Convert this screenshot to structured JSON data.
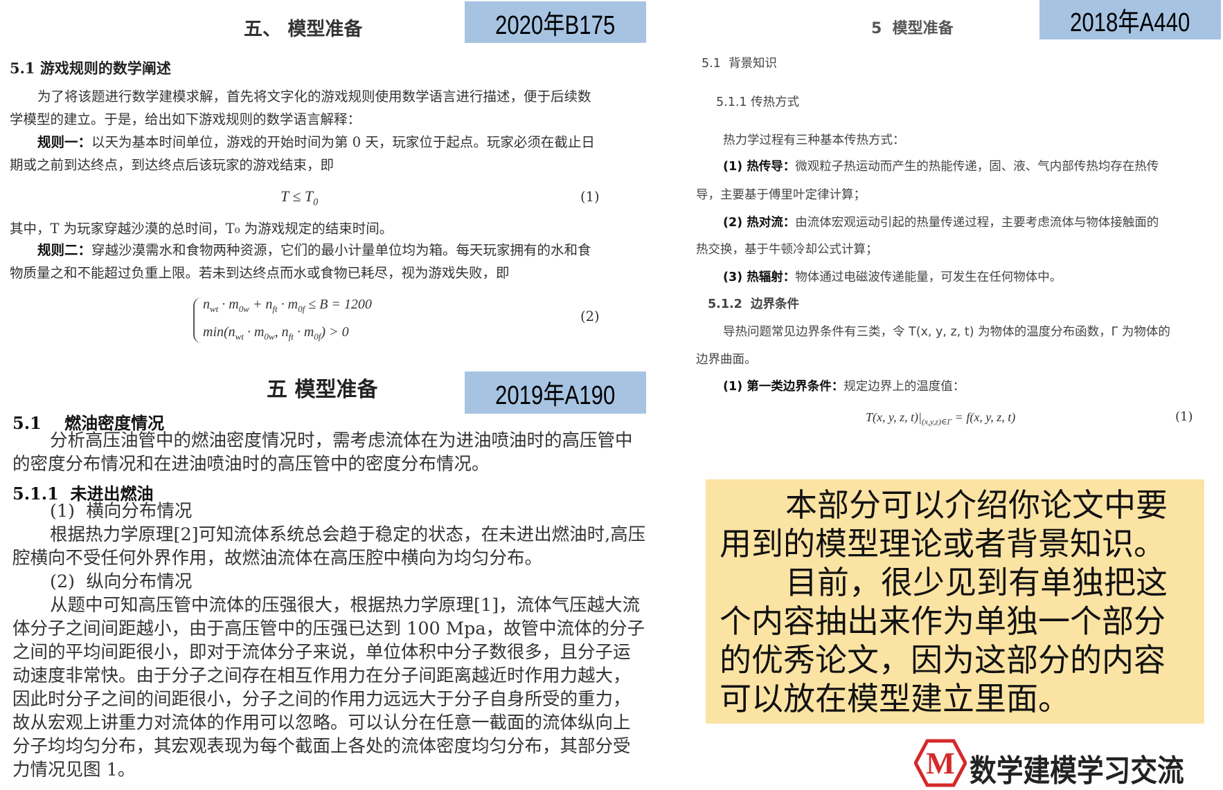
{
  "doc2020": {
    "tag": "2020年B175",
    "title": "五、 模型准备",
    "section": "5.1 游戏规则的数学阐述",
    "p1": [
      "为了将该题进行数学建模求解，首先将文字化的游戏规则使用数学语言进行描述，便于后续数",
      "学模型的建立。于是，给出如下游戏规则的数学语言解释："
    ],
    "rule1_label": "规则一：",
    "rule1": [
      "以天为基本时间单位，游戏的开始时间为第 0 天，玩家位于起点。玩家必须在截止日",
      "期或之前到达终点，到达终点后该玩家的游戏结束，即"
    ],
    "eq1": [
      [
        "T ≤ T",
        "0"
      ]
    ],
    "eq1_num": "(1)",
    "where": "其中，T 为玩家穿越沙漠的总时间，T₀ 为游戏规定的结束时间。",
    "rule2_label": "规则二：",
    "rule2": [
      "穿越沙漠需水和食物两种资源，它们的最小计量单位均为箱。每天玩家拥有的水和食",
      "物质量之和不能超过负重上限。若未到达终点而水或食物已耗尽，视为游戏失败，即"
    ],
    "eq2a": [
      [
        "n",
        "wt"
      ],
      [
        " · m",
        "0w"
      ],
      [
        " + n",
        "ft"
      ],
      [
        " · m",
        "0f"
      ],
      [
        " ≤ B = 1200",
        ""
      ]
    ],
    "eq2b": [
      [
        "min(n",
        "wt"
      ],
      [
        " · m",
        "0w"
      ],
      [
        ", n",
        "ft"
      ],
      [
        " · m",
        "0f"
      ],
      [
        ") > 0",
        ""
      ]
    ],
    "eq2_num": "(2)"
  },
  "doc2019": {
    "tag": "2019年A190",
    "title": "五  模型准备",
    "section": "5.1    燃油密度情况",
    "p1": [
      "分析高压油管中的燃油密度情况时，需考虑流体在为进油喷油时的高压管中",
      "的密度分布情况和在进油喷油时的高压管中的密度分布情况。"
    ],
    "sub": "5.1.1  未进出燃油",
    "item1": "(1)  横向分布情况",
    "p2": [
      "根据热力学原理[2]可知流体系统总会趋于稳定的状态，在未进出燃油时,高压",
      "腔横向不受任何外界作用，故燃油流体在高压腔中横向为均匀分布。"
    ],
    "item2": "(2)  纵向分布情况",
    "p3": [
      "从题中可知高压管中流体的压强很大，根据热力学原理[1]，流体气压越大流",
      "体分子之间间距越小，由于高压管中的压强已达到 100 Mpa，故管中流体的分子",
      "之间的平均间距很小，即对于流体分子来说，单位体积中分子数很多，且分子运",
      "动速度非常快。由于分子之间存在相互作用力在分子间距离越近时作用力越大，",
      "因此时分子之间的间距很小，分子之间的作用力远远大于分子自身所受的重力，",
      "故从宏观上讲重力对流体的作用可以忽略。可以认分在任意一截面的流体纵向上",
      "分子均均匀分布，其宏观表现为每个截面上各处的流体密度均匀分布，其部分受",
      "力情况见图 1。"
    ]
  },
  "doc2018": {
    "tag": "2018年A440",
    "title": "5  模型准备",
    "s1": "5.1  背景知识",
    "s11": "5.1.1 传热方式",
    "intro": "热力学过程有三种基本传热方式：",
    "i1_label": "(1) 热传导：",
    "i1": "微观粒子热运动而产生的热能传递，固、液、气内部传热均存在热传",
    "i1b": "导，主要基于傅里叶定律计算；",
    "i2_label": "(2) 热对流：",
    "i2": "由流体宏观运动引起的热量传递过程，主要考虑流体与物体接触面的",
    "i2b": "热交换，基于牛顿冷却公式计算；",
    "i3_label": "(3) 热辐射：",
    "i3": "物体通过电磁波传递能量，可发生在任何物体中。",
    "s12": "5.1.2  边界条件",
    "p1": "导热问题常见边界条件有三类，令 T(x, y, z, t) 为物体的温度分布函数，Γ 为物体的",
    "p1b": "边界曲面。",
    "c1_label": "(1) 第一类边界条件：",
    "c1": "规定边界上的温度值：",
    "eq": [
      [
        "T(x, y, z, t)|",
        "(x,y,z)∈Γ"
      ],
      [
        " = f(x, y, z, t)",
        ""
      ]
    ],
    "eq_num": "(1)"
  },
  "note": {
    "lines": [
      "本部分可以介绍你论文中要",
      "用到的模型理论或者背景知识。",
      "目前，很少见到有单独把这",
      "个内容抽出来作为单独一个部分",
      "的优秀论文，因为这部分的内容",
      "可以放在模型建立里面。"
    ]
  },
  "logo": {
    "mark": "M",
    "text": "数学建模学习交流"
  },
  "colors": {
    "tag_bg": "#a7c3e2",
    "note_bg": "#fbe3a3",
    "logo_red": "#d42a2a"
  }
}
